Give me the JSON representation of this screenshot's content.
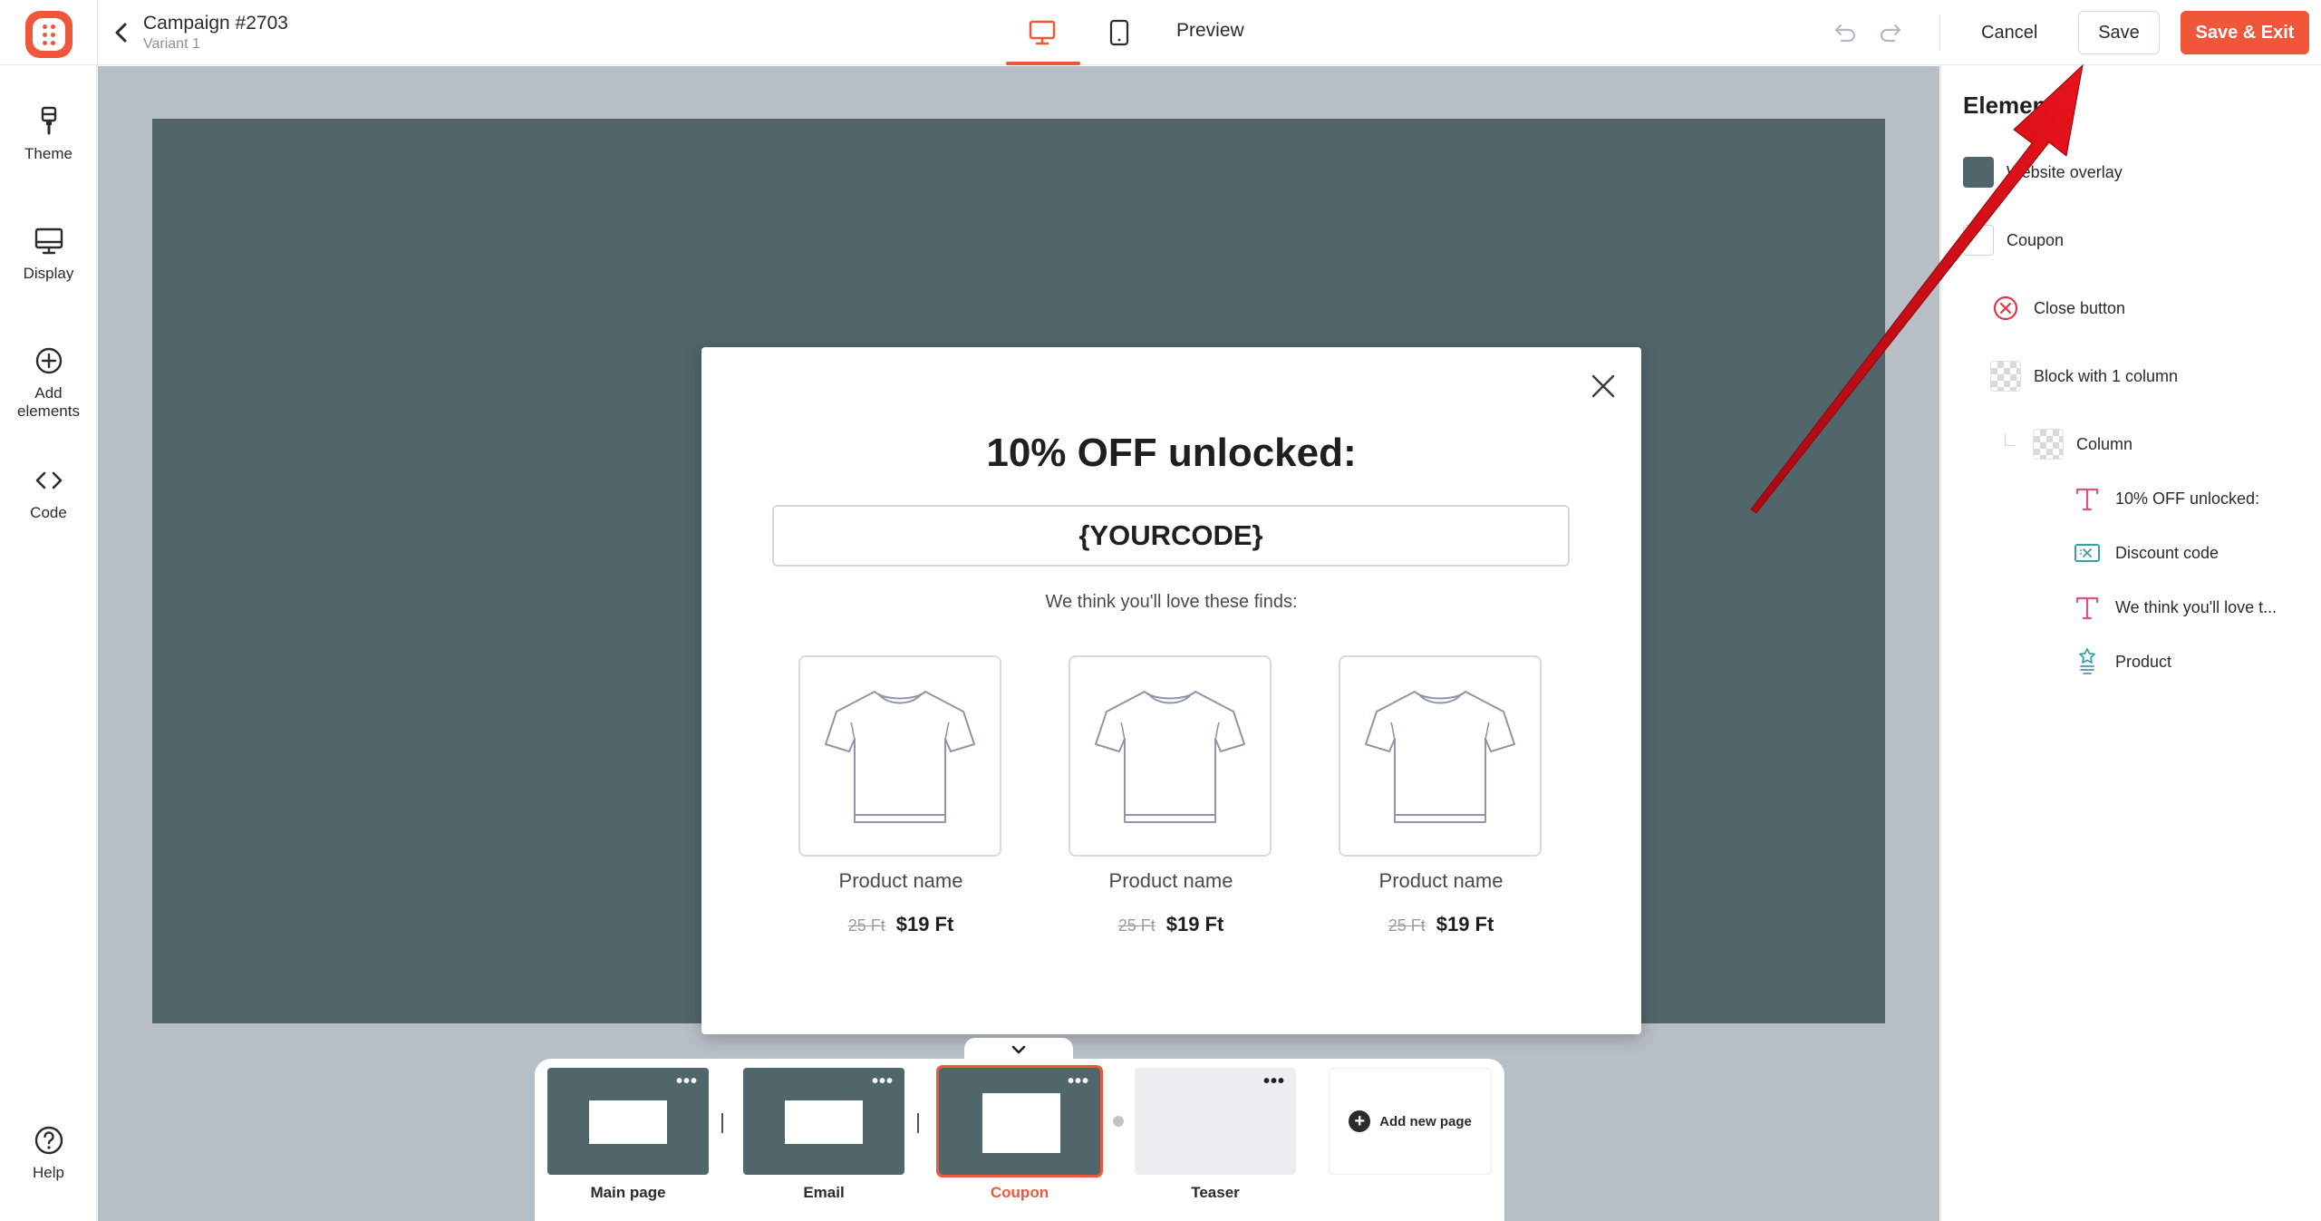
{
  "header": {
    "campaign_title": "Campaign #2703",
    "variant": "Variant 1",
    "preview_label": "Preview",
    "cancel_label": "Cancel",
    "save_label": "Save",
    "save_exit_label": "Save & Exit",
    "active_device": "desktop-icon"
  },
  "sidebar": {
    "items": [
      {
        "label": "Theme",
        "icon": "brush-icon"
      },
      {
        "label": "Display",
        "icon": "monitor-icon"
      },
      {
        "label": "Add elements",
        "icon": "plus-circle-icon"
      },
      {
        "label": "Code",
        "icon": "code-icon"
      }
    ],
    "help_label": "Help"
  },
  "popup": {
    "title": "10% OFF unlocked:",
    "coupon_code": "{YOURCODE}",
    "subtitle": "We think you'll love these finds:",
    "products": [
      {
        "name": "Product name",
        "old_price": "25 Ft",
        "price": "$19 Ft"
      },
      {
        "name": "Product name",
        "old_price": "25 Ft",
        "price": "$19 Ft"
      },
      {
        "name": "Product name",
        "old_price": "25 Ft",
        "price": "$19 Ft"
      }
    ]
  },
  "pages": {
    "items": [
      {
        "label": "Main page",
        "selected": false
      },
      {
        "label": "Email",
        "selected": false
      },
      {
        "label": "Coupon",
        "selected": true
      },
      {
        "label": "Teaser",
        "selected": false
      }
    ],
    "add_label": "Add new page"
  },
  "elements_panel": {
    "title": "Elements",
    "items": [
      {
        "label": "Website overlay",
        "icon": "overlay-swatch-icon"
      },
      {
        "label": "Coupon",
        "icon": "page-swatch-icon"
      },
      {
        "label": "Close button",
        "icon": "close-circle-icon"
      },
      {
        "label": "Block with 1 column",
        "icon": "block-icon"
      },
      {
        "label": "Column",
        "icon": "column-icon"
      },
      {
        "label": "10% OFF unlocked:",
        "icon": "text-icon"
      },
      {
        "label": "Discount code",
        "icon": "coupon-icon"
      },
      {
        "label": "We think you'll love t...",
        "icon": "text-icon"
      },
      {
        "label": "Product",
        "icon": "product-icon"
      }
    ]
  },
  "colors": {
    "accent": "#f0573a",
    "overlay": "#50666b",
    "canvas_bg": "#b8bec6",
    "annotation_arrow": "#d0101a"
  }
}
